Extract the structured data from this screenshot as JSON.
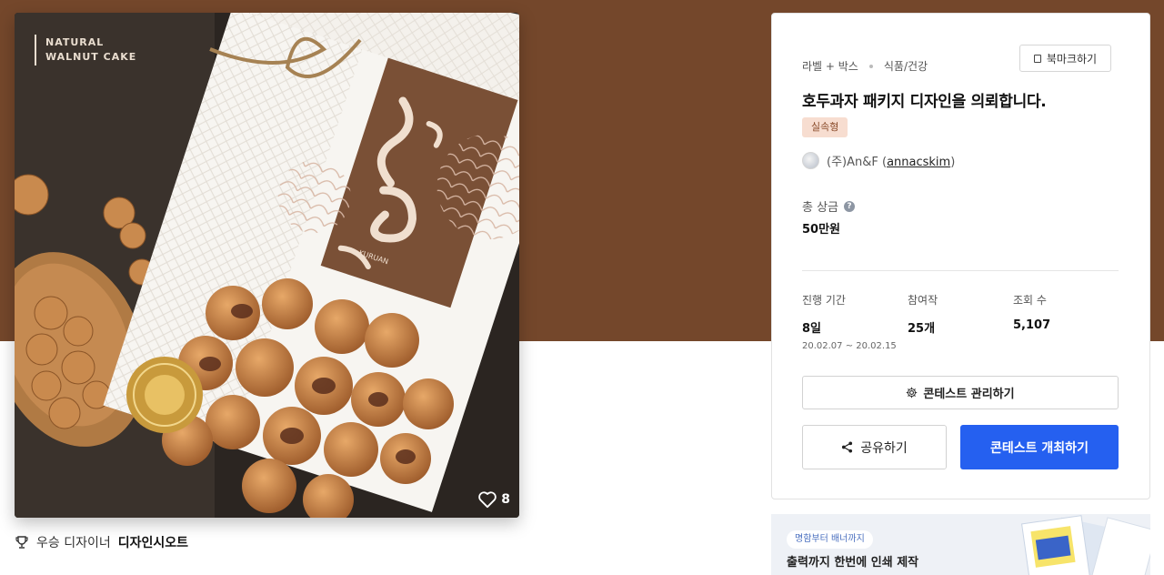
{
  "image_card": {
    "like_count": "8",
    "box_text_top": "NATURAL\nWALNUT CAKE",
    "box_brand_en": "KURUAN"
  },
  "winner": {
    "prefix": "우승 디자이너",
    "name": "디자인시오트"
  },
  "contest": {
    "category_main": "라벨 + 박스",
    "category_sub": "식품/건강",
    "bookmark_label": "북마크하기",
    "title": "호두과자 패키지 디자인을 의뢰합니다.",
    "badge": "실속형",
    "host_company": "(주)An&F (",
    "host_id": "annacskim",
    "host_close": ")",
    "prize_label": "총 상금",
    "prize_help": "?",
    "prize_value": "50만원",
    "stats": [
      {
        "label": "진행 기간",
        "value": "8일",
        "sub": "20.02.07 ~ 20.02.15"
      },
      {
        "label": "참여작",
        "value": "25개"
      },
      {
        "label": "조회 수",
        "value": "5,107"
      }
    ],
    "manage_label": "콘테스트 관리하기",
    "share_label": "공유하기",
    "host_contest_label": "콘테스트 개최하기"
  },
  "ad": {
    "chip": "명함부터 배너까지",
    "text": "출력까지 한번에 인쇄 제작"
  },
  "colors": {
    "brown_band": "#74472b",
    "primary_blue": "#2560f0",
    "badge_bg": "#f7ddd0"
  }
}
